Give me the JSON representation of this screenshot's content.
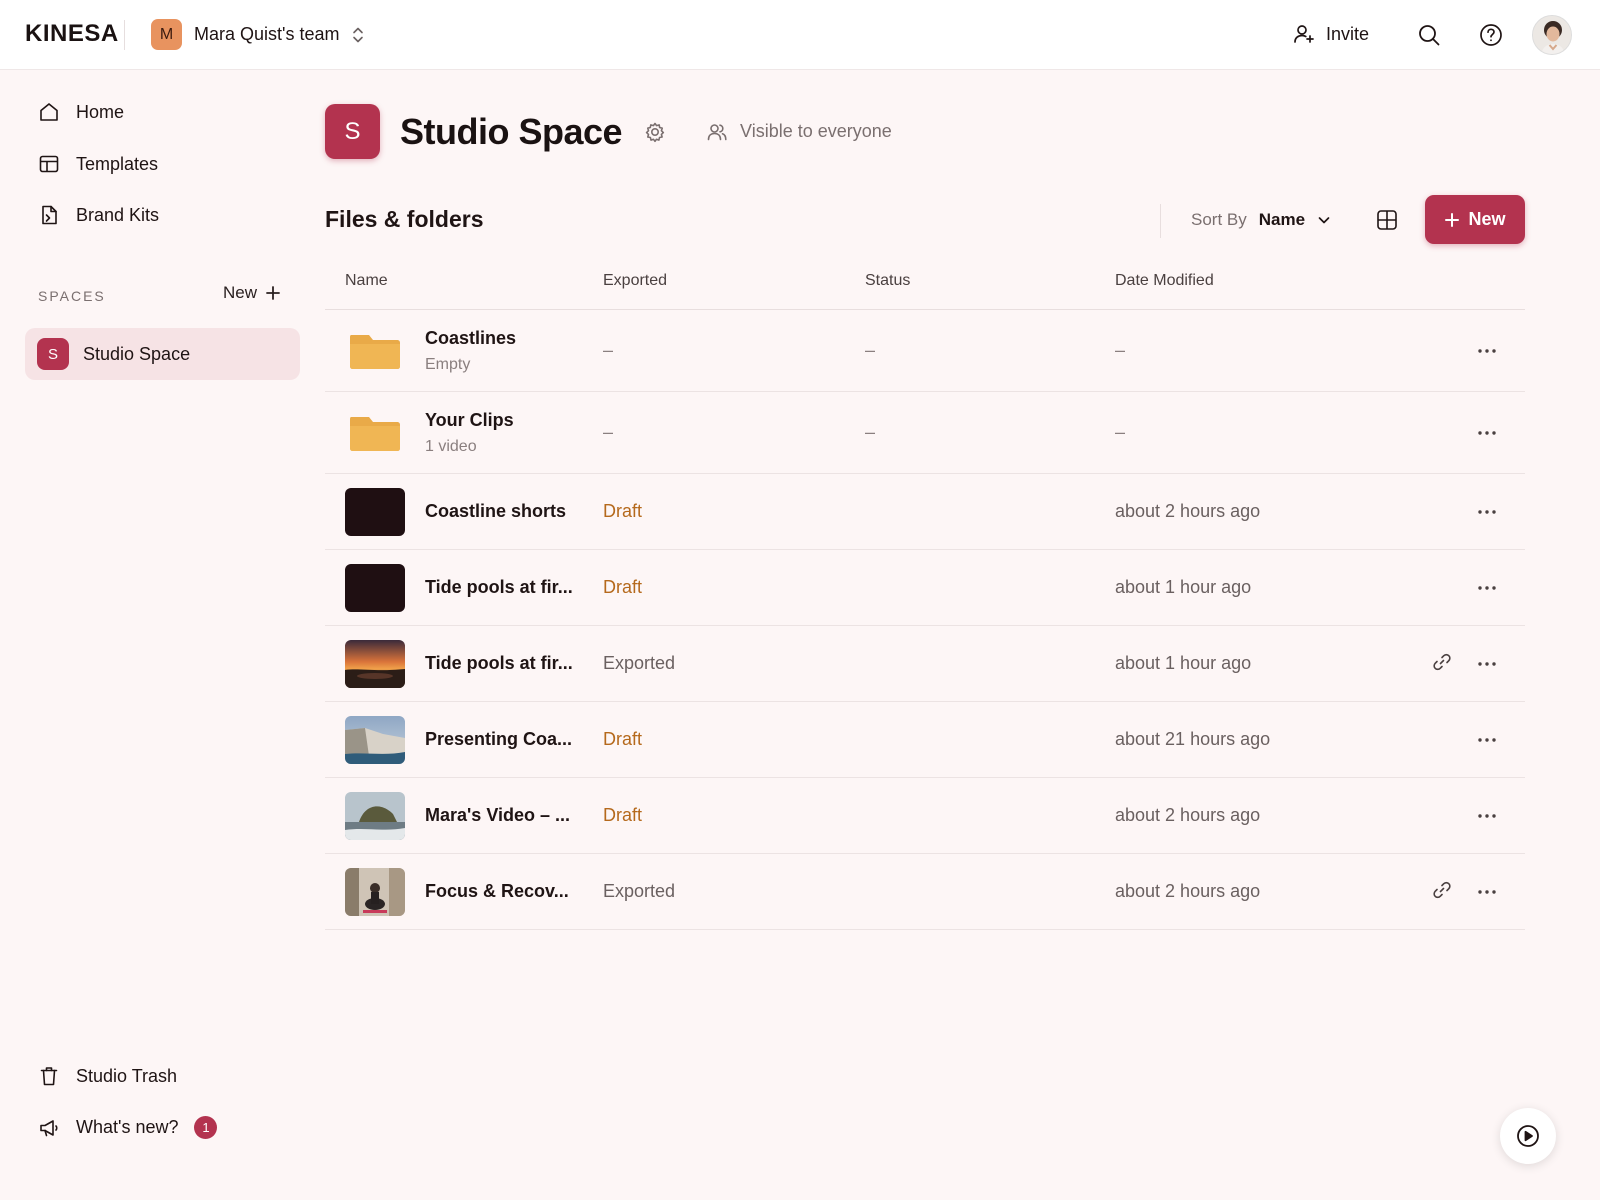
{
  "brand": "KINESA",
  "team": {
    "initial": "M",
    "name": "Mara Quist's team"
  },
  "topbar": {
    "invite_label": "Invite"
  },
  "nav": [
    {
      "label": "Home",
      "icon": "home-icon"
    },
    {
      "label": "Templates",
      "icon": "templates-icon"
    },
    {
      "label": "Brand Kits",
      "icon": "brand-kits-icon"
    }
  ],
  "spaces": {
    "label": "SPACES",
    "new_label": "New",
    "items": [
      {
        "initial": "S",
        "name": "Studio Space"
      }
    ]
  },
  "footer_nav": {
    "trash_label": "Studio Trash",
    "whats_new_label": "What's new?",
    "whats_new_count": "1"
  },
  "space": {
    "initial": "S",
    "title": "Studio Space",
    "visibility": "Visible to everyone"
  },
  "files": {
    "title": "Files & folders",
    "sort_label": "Sort By",
    "sort_value": "Name",
    "new_label": "New",
    "columns": [
      "Name",
      "Exported",
      "Status",
      "Date Modified"
    ],
    "rows": [
      {
        "kind": "folder",
        "name": "Coastlines",
        "sub": "Empty",
        "exported": "–",
        "status": "–",
        "modified": "–"
      },
      {
        "kind": "folder",
        "name": "Your Clips",
        "sub": "1 video",
        "exported": "–",
        "status": "–",
        "modified": "–"
      },
      {
        "kind": "file",
        "thumb": "dark",
        "name": "Coastline shorts",
        "exported": "Draft",
        "modified": "about 2 hours ago"
      },
      {
        "kind": "file",
        "thumb": "dark",
        "name": "Tide pools at fir...",
        "exported": "Draft",
        "modified": "about 1 hour ago"
      },
      {
        "kind": "file",
        "thumb": "sunset",
        "name": "Tide pools at fir...",
        "exported": "Exported",
        "modified": "about 1 hour ago",
        "link": true
      },
      {
        "kind": "file",
        "thumb": "cliffs",
        "name": "Presenting Coa...",
        "exported": "Draft",
        "modified": "about 21 hours ago"
      },
      {
        "kind": "file",
        "thumb": "headland",
        "name": "Mara's Video – ...",
        "exported": "Draft",
        "modified": "about 2 hours ago"
      },
      {
        "kind": "file",
        "thumb": "yoga",
        "name": "Focus & Recov...",
        "exported": "Exported",
        "modified": "about 2 hours ago",
        "link": true
      }
    ]
  },
  "colors": {
    "accent": "#b3334f",
    "draft": "#b5691c",
    "team_avatar": "#e8935f",
    "folder": "#e9aa48",
    "background": "#fdf6f6"
  }
}
